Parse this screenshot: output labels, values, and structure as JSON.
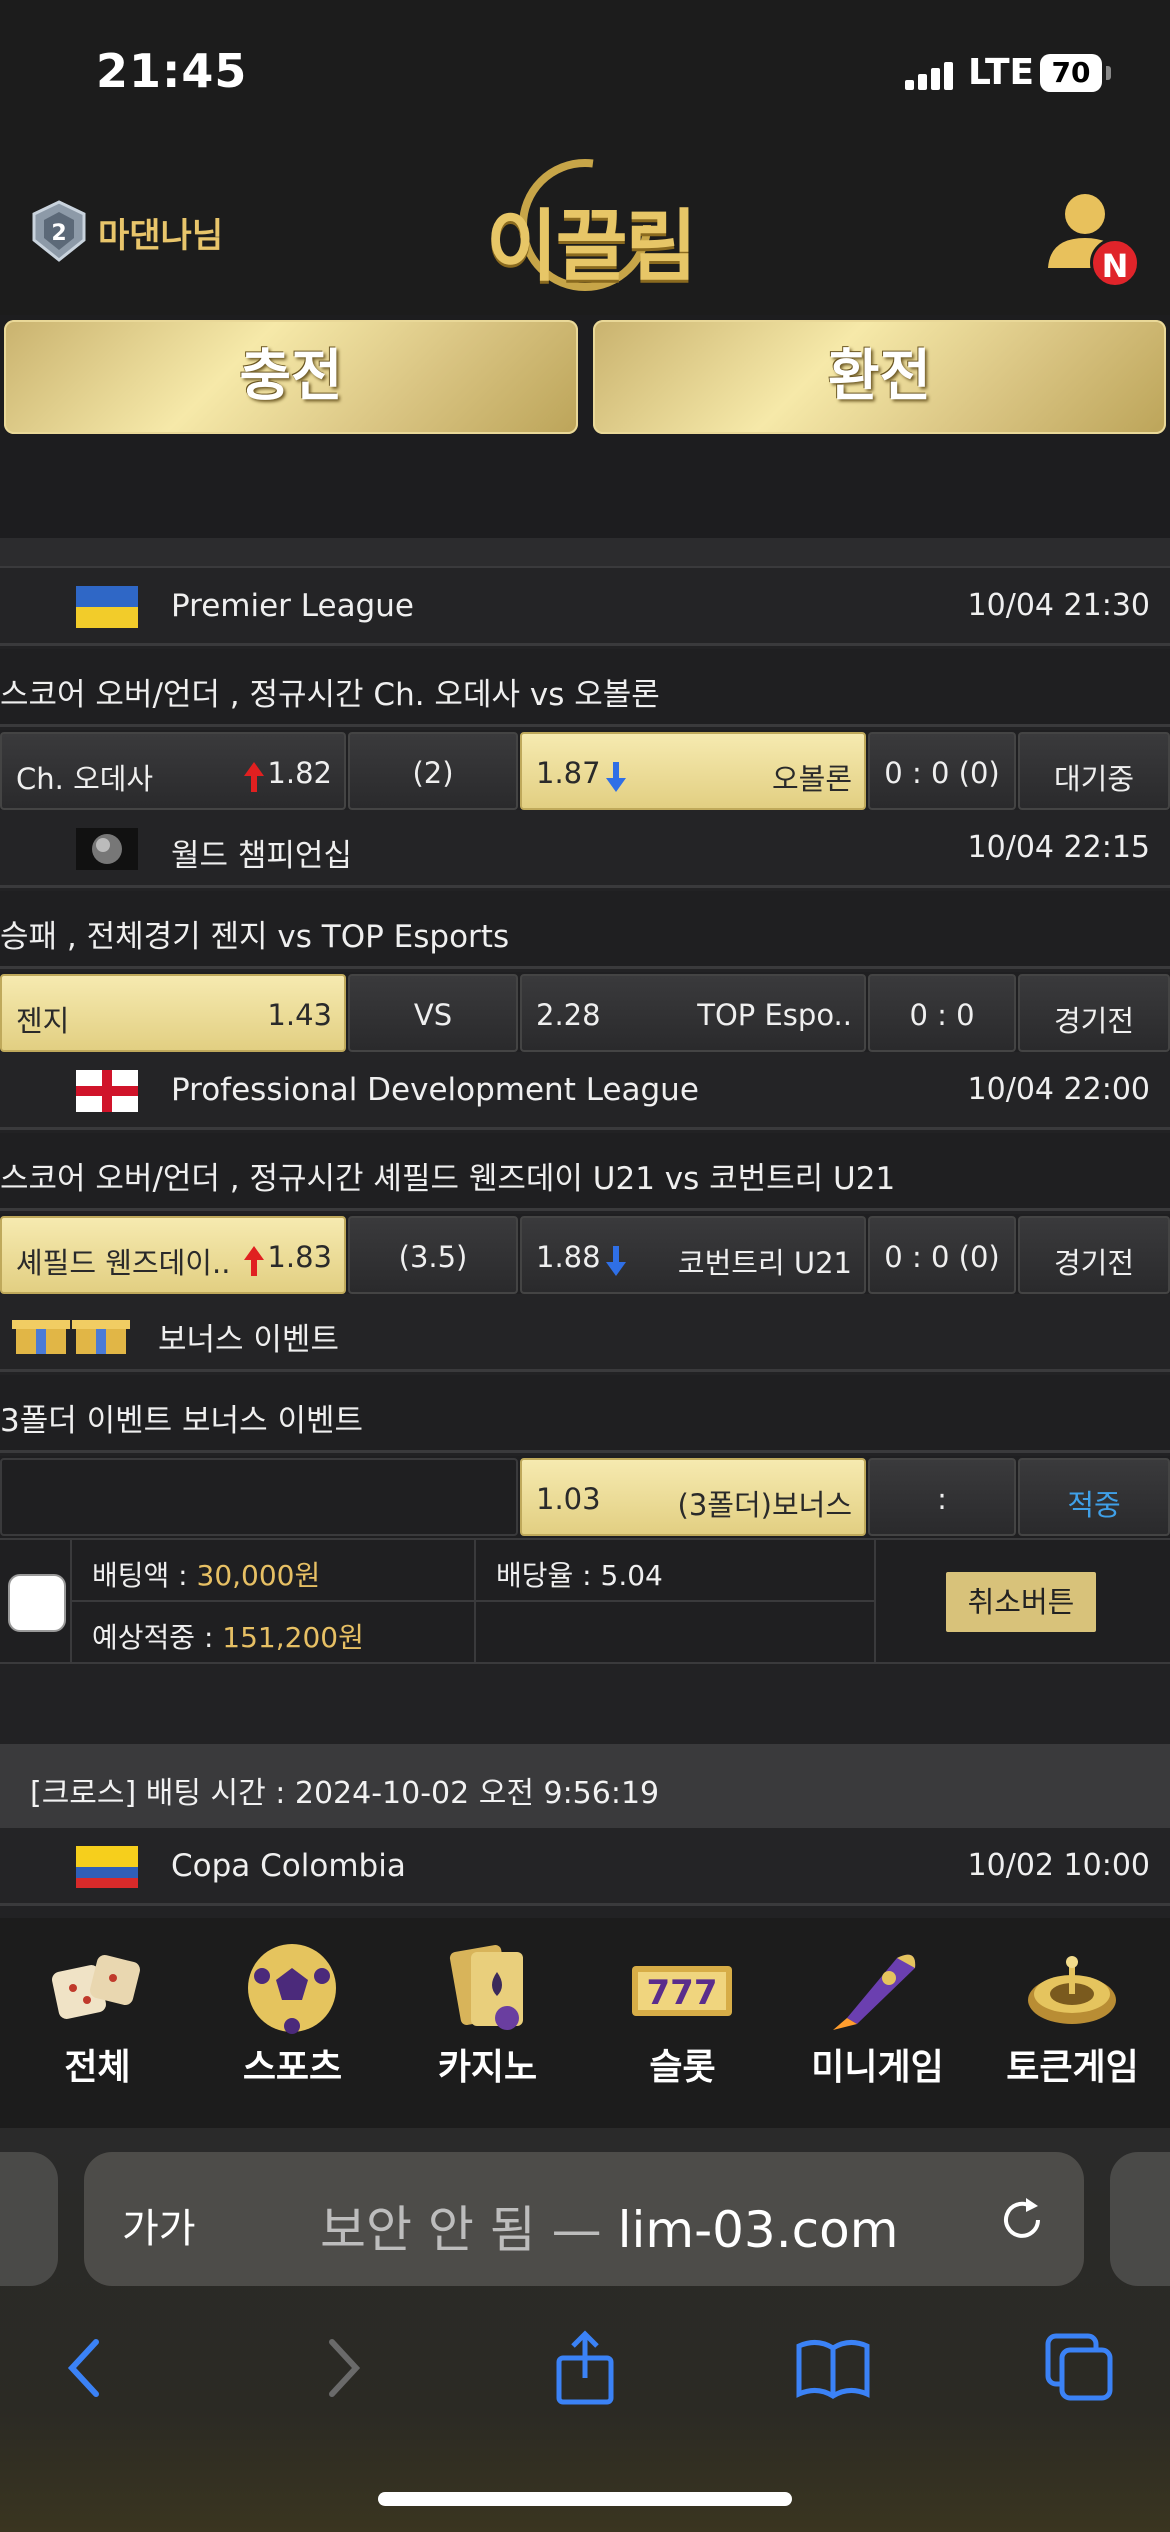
{
  "status_bar": {
    "time": "21:45",
    "network": "LTE",
    "battery": "70"
  },
  "header": {
    "user_name": "마댄나님",
    "logo_text": "이끌림",
    "notification_badge": "N",
    "charge_label": "충전",
    "exchange_label": "환전"
  },
  "matches": [
    {
      "league": "Premier League",
      "date": "10/04 21:30",
      "description": "스코어 오버/언더 , 정규시간 Ch. 오데사  vs  오볼론",
      "home": "Ch. 오데사",
      "home_odds": "1.82",
      "mid": "(2)",
      "away_odds": "1.87",
      "away": "오볼론",
      "score": "0 : 0 (0)",
      "status": "대기중"
    },
    {
      "league": "월드 챔피언십",
      "date": "10/04 22:15",
      "description": "승패 , 전체경기 젠지  vs  TOP Esports",
      "home": "젠지",
      "home_odds": "1.43",
      "mid": "VS",
      "away_odds": "2.28",
      "away": "TOP Espo..",
      "score": "0 : 0",
      "status": "경기전"
    },
    {
      "league": "Professional Development League",
      "date": "10/04 22:00",
      "description": "스코어 오버/언더 , 정규시간 셰필드 웬즈데이 U21  vs  코번트리 U21",
      "home": "셰필드 웬즈데이..",
      "home_odds": "1.83",
      "mid": "(3.5)",
      "away_odds": "1.88",
      "away": "코번트리 U21",
      "score": "0 : 0 (0)",
      "status": "경기전"
    }
  ],
  "bonus": {
    "league": "보너스 이벤트",
    "description": "3폴더 이벤트 보너스 이벤트",
    "odds": "1.03",
    "label": "(3폴더)보너스",
    "score": ":",
    "status": "적중"
  },
  "summary": {
    "bet_amount_label": "배팅액 : ",
    "bet_amount": "30,000원",
    "odds_label": "배당율 : 5.04",
    "expected_label": "예상적중 : ",
    "expected": "151,200원",
    "cancel_label": "취소버튼"
  },
  "cross": {
    "text": "[크로스] 배팅 시간 : 2024-10-02 오전 9:56:19",
    "league": "Copa Colombia",
    "date": "10/02 10:00"
  },
  "game_nav": [
    {
      "label": "전체",
      "icon": "dice-icon"
    },
    {
      "label": "스포츠",
      "icon": "soccer-ball-icon"
    },
    {
      "label": "카지노",
      "icon": "cards-icon"
    },
    {
      "label": "슬롯",
      "icon": "slot-777-icon"
    },
    {
      "label": "미니게임",
      "icon": "rocket-icon"
    },
    {
      "label": "토큰게임",
      "icon": "roulette-icon"
    }
  ],
  "browser": {
    "text_size_label": "가가",
    "url_prefix": "보안 안 됨 — ",
    "url": "lim-03.com"
  },
  "colors": {
    "gold": "#e7c064",
    "selected_odds": "#f1e3a2",
    "up_arrow": "#e02020",
    "down_arrow": "#2f6fe6",
    "hit_status": "#3fa0e8"
  }
}
